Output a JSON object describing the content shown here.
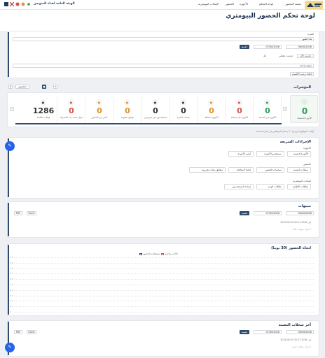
{
  "topbar": {
    "brand": "الهيئة العامة لقناة السويس",
    "nav": [
      "الرئيسية",
      "بصمة الحضور",
      "لوحة التحكم",
      "الأجهزة",
      "الحضور",
      "البيانات البيومترية"
    ]
  },
  "page": {
    "title": "لوحة تحكم الحضور البيومتري"
  },
  "filters": {
    "period_label": "الفترة",
    "month_label": "هذا الشهر",
    "date_from": "06/30/2026",
    "date_to": "07/30/2026",
    "apply_label": "تطبيق",
    "refresh_label": "تحديث الآن",
    "auto_label": "تحديث تلقائي",
    "auto_value": "كل",
    "interval_value": "دقيقة واحدة",
    "reorder_label": "إعادة ترتيب الأقسام"
  },
  "indicators": {
    "title": "المؤشرات",
    "customize_label": "تخصيص",
    "main_value": "0",
    "main_caption": "الأجهزة المتصلة",
    "items": [
      {
        "value": "0",
        "caption": "الأجهزة في الخدمة",
        "color": "#2e9e5b",
        "icon": "warning-icon"
      },
      {
        "value": "0",
        "caption": "الأجهزة غير متصلة",
        "color": "#d9534f",
        "icon": "error-icon"
      },
      {
        "value": "0",
        "caption": "الأجهزة معطلة",
        "color": "#e0932e",
        "icon": "sleep-icon"
      },
      {
        "value": "0",
        "caption": "بصمات الفترة",
        "color": "#333",
        "icon": "fingerprint-icon"
      },
      {
        "value": "0",
        "caption": "مستخدمون غير موجودين",
        "color": "#333",
        "icon": "user-icon"
      },
      {
        "value": "0",
        "caption": "تواقيع مفقودة",
        "color": "#e0932e",
        "icon": "clock-icon"
      },
      {
        "value": "0",
        "caption": "تأخير عن الحضور",
        "color": "#e0932e",
        "icon": "late-icon"
      },
      {
        "value": "0",
        "caption": "دخول متعدد منذ الانصراف",
        "color": "#d9534f",
        "icon": "multi-icon"
      },
      {
        "value": "1286",
        "caption": "قوالب مطابقة",
        "color": "#333",
        "icon": "template-icon"
      }
    ],
    "note": "أوقات المواقع (تجريبي) - لا يشمل الموظفين في إجازة معتمدة"
  },
  "quick": {
    "title": "الإجراءات السريعة",
    "groups": [
      {
        "label": "الأجهزة",
        "items": [
          "الأجهزة البصمة",
          "مستخدمو الأجهزة",
          "أوامر الأجهزة"
        ]
      },
      {
        "label": "الحضور",
        "items": [
          "سجلات البصمة",
          "سياسات الحضور",
          "إعادة المعالجة",
          "مطابق بيانات تجريبية"
        ]
      },
      {
        "label": "البيانات البيومترية",
        "items": [
          "بطاقات الاطباع",
          "بطاقات الوجه",
          "قراءة المستخدمين"
        ]
      }
    ]
  },
  "alerts": {
    "title": "تنبيهات",
    "date_from": "06/30/2026",
    "date_to": "07/30/2026",
    "filter_label": "تصفية",
    "excel_label": "Excel",
    "pdf_label": "PDF",
    "range_text": "2026-06-30 إلى 2026-07-30",
    "empty_text": "لا توجد تنبيهات حاليا"
  },
  "trend": {
    "title": "اتجاه الحضور (30 يوما)",
    "legend": [
      "حالات متأخرة",
      "تسجيلات الحضور"
    ]
  },
  "chart_data": {
    "type": "line",
    "title": "اتجاه الحضور (30 يوما)",
    "series": [
      {
        "name": "حالات متأخرة",
        "values": []
      },
      {
        "name": "تسجيلات الحضور",
        "values": []
      }
    ],
    "ylim": [
      0,
      1
    ],
    "yticks": [
      "1.0",
      "0.9",
      "0.8",
      "0.7",
      "0.6",
      "0.5",
      "0.4",
      "0.3",
      "0.2",
      "0.1",
      "0"
    ]
  },
  "latest": {
    "title": "آخر سجلات البصمة",
    "date_from": "06/30/2026",
    "date_to": "07/30/2026",
    "filter_label": "تصفية",
    "excel_label": "Excel",
    "pdf_label": "PDF",
    "range_text": "2026-06-30 إلى 2026-07-30",
    "empty_text": "لا توجد سجلات اليوم"
  },
  "colors": {
    "primary": "#2e4a6d",
    "fab": "#2563eb"
  }
}
